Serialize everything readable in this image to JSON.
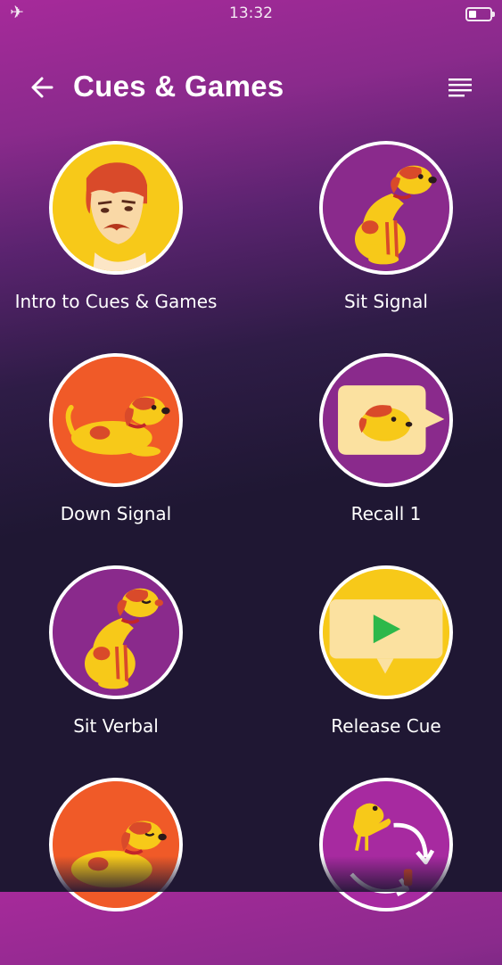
{
  "status_bar": {
    "time": "13:32"
  },
  "header": {
    "title": "Cues & Games"
  },
  "lessons": [
    {
      "label": "Intro to Cues & Games",
      "art": "trainer-face-icon"
    },
    {
      "label": "Sit Signal",
      "art": "dog-sitting-icon"
    },
    {
      "label": "Down Signal",
      "art": "dog-lying-down-icon"
    },
    {
      "label": "Recall 1",
      "art": "dog-speech-bubble-icon"
    },
    {
      "label": "Sit Verbal",
      "art": "dog-sitting-eyes-closed-icon"
    },
    {
      "label": "Release Cue",
      "art": "video-play-icon"
    },
    {
      "label": "",
      "art": "dog-lying-eyes-closed-icon"
    },
    {
      "label": "",
      "art": "cycle-arrows-icon"
    }
  ],
  "colors": {
    "accent_yellow": "#f7c919",
    "accent_orange": "#f05a28",
    "accent_purple": "#8a2a8c",
    "background": "#1f1733"
  }
}
